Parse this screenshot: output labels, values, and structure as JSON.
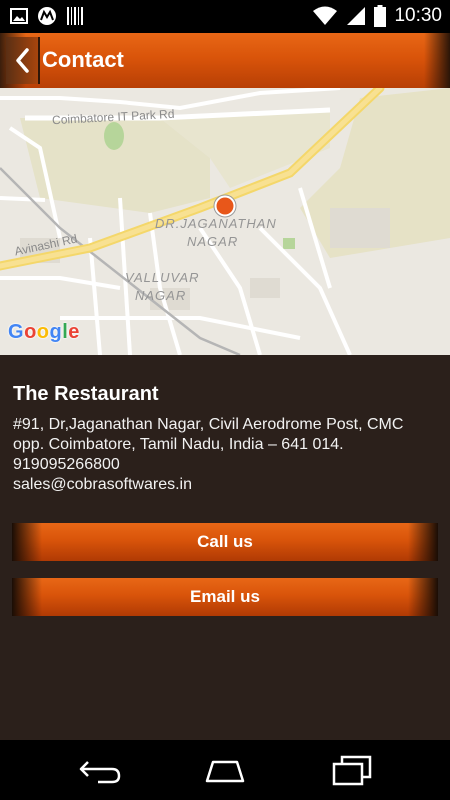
{
  "status_bar": {
    "time": "10:30",
    "left_icons": [
      "image-icon",
      "motorola-icon",
      "barcode-icon"
    ],
    "right_icons": [
      "wifi-icon",
      "signal-icon",
      "battery-icon"
    ]
  },
  "app_bar": {
    "title": "Contact",
    "back_icon": "chevron-left-icon",
    "accent": "#d9540a"
  },
  "map": {
    "roads": {
      "it_park": "Coimbatore IT Park Rd",
      "avinashi": "Avinashi Rd"
    },
    "areas": {
      "jaganathan_1": "DR.JAGANATHAN",
      "jaganathan_2": "NAGAR",
      "valluvar_1": "VALLUVAR",
      "valluvar_2": "NAGAR"
    },
    "logo": "Google",
    "marker_color": "#e8571a"
  },
  "restaurant": {
    "name": "The Restaurant",
    "address_line1": "#91, Dr,Jaganathan Nagar, Civil Aerodrome Post, CMC",
    "address_line2": "opp. Coimbatore, Tamil Nadu, India – 641 014.",
    "phone": "919095266800",
    "email": "sales@cobrasoftwares.in"
  },
  "actions": {
    "call_label": "Call us",
    "email_label": "Email us"
  },
  "nav_bar": {
    "icons": [
      "back-icon",
      "home-icon",
      "recents-icon"
    ]
  },
  "colors": {
    "background": "#2b201b",
    "button_orange": "#d9540a"
  }
}
